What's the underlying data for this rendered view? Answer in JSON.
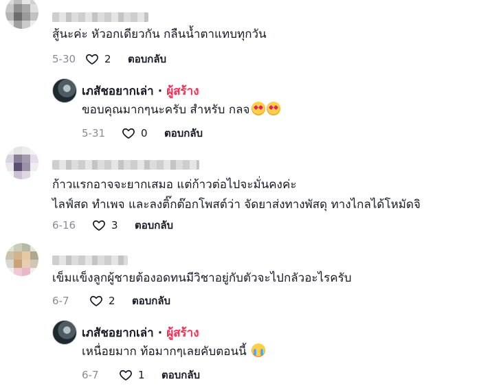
{
  "colors": {
    "creator_badge": "#fe2c55",
    "meta_gray": "#8a8b91",
    "text": "#161823"
  },
  "comments": [
    {
      "text_lines": [
        "สู้นะค่ะ หัวอกเดียวกัน กลืนน้ำตาแทบทุกวัน"
      ],
      "date": "5-30",
      "likes": "2",
      "reply_label": "ตอบกลับ",
      "reply": {
        "author": "เภสัชอยากเล่า",
        "separator": "·",
        "creator_label": "ผู้สร้าง",
        "text": "ขอบคุณมากๆนะครับ สำหรับ กลจ",
        "emoji": [
          "smiling-face-with-hearts",
          "smiling-face-with-hearts"
        ],
        "date": "5-31",
        "likes": "0",
        "reply_label": "ตอบกลับ"
      }
    },
    {
      "text_lines": [
        "ก้าวแรกอาจจะยากเสมอ แต่ก้าวต่อไปจะมั่นคงค่ะ",
        "ไลฟ์สด ทำเพจ และลงติ๊กต๊อกโพสต์ว่า จัดยาส่งทางพัสดุ ทางไกลได้โหมัดจิ"
      ],
      "date": "6-16",
      "likes": "3",
      "reply_label": "ตอบกลับ"
    },
    {
      "text_lines": [
        "เข็มแข็งลูกผู้ชายต้องอดทนมีวิชาอยู่กับตัวจะไปกลัวอะไรครับ"
      ],
      "date": "6-7",
      "likes": "2",
      "reply_label": "ตอบกลับ",
      "reply": {
        "author": "เภสัชอยากเล่า",
        "separator": "·",
        "creator_label": "ผู้สร้าง",
        "text": "เหนื่อยมาก ท้อมากๆเลยคับตอนนี้",
        "emoji": [
          "loudly-crying-face"
        ],
        "date": "6-7",
        "likes": "1",
        "reply_label": "ตอบกลับ"
      }
    }
  ]
}
